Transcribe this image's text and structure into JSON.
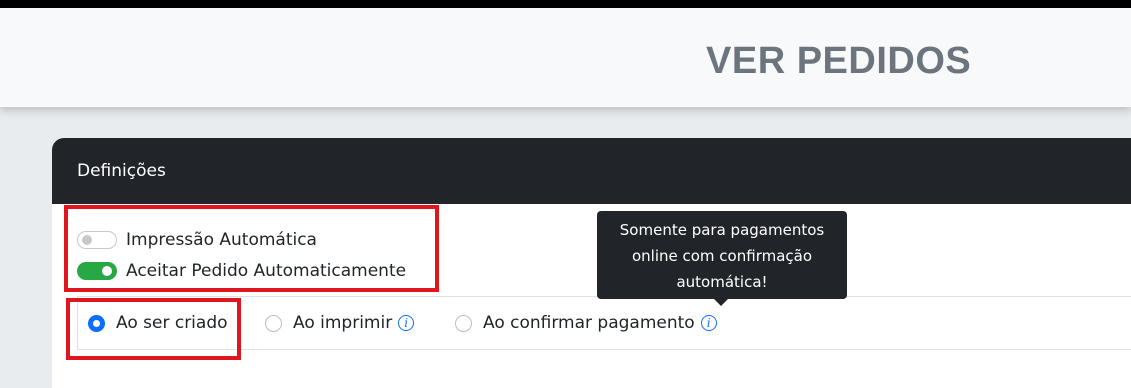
{
  "header": {
    "title": "VER PEDIDOS"
  },
  "card": {
    "title": "Definições"
  },
  "switches": [
    {
      "label": "Impressão Automática",
      "state": "off"
    },
    {
      "label": "Aceitar Pedido Automaticamente",
      "state": "on"
    }
  ],
  "radios": [
    {
      "label": "Ao ser criado",
      "checked": true,
      "info_icon": false
    },
    {
      "label": "Ao imprimir",
      "checked": false,
      "info_icon": true
    },
    {
      "label": "Ao confirmar pagamento",
      "checked": false,
      "info_icon": true
    }
  ],
  "tooltip": {
    "lines": [
      "Somente para pagamentos",
      "online com confirmação",
      "automática!"
    ]
  },
  "colors": {
    "accent": "#0d6efd",
    "switch_on": "#28a745",
    "card_header": "#212529",
    "highlight": "#e0161e"
  },
  "icons": {
    "info": "info-circle-icon"
  }
}
